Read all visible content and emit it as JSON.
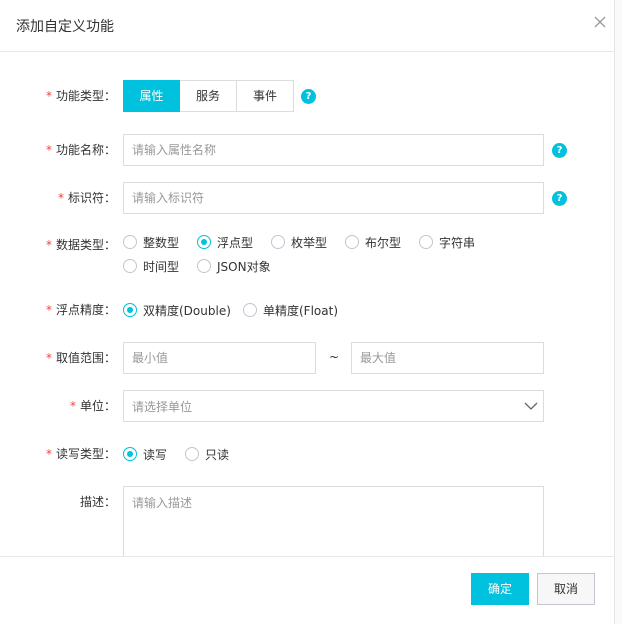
{
  "dialog": {
    "title": "添加自定义功能"
  },
  "required_mark": "*",
  "func_type": {
    "label": "功能类型：",
    "options": [
      "属性",
      "服务",
      "事件"
    ],
    "selected": "属性"
  },
  "func_name": {
    "label": "功能名称：",
    "placeholder": "请输入属性名称"
  },
  "identifier": {
    "label": "标识符：",
    "placeholder": "请输入标识符"
  },
  "data_type": {
    "label": "数据类型：",
    "options": [
      "整数型",
      "浮点型",
      "枚举型",
      "布尔型",
      "字符串",
      "时间型",
      "JSON对象"
    ],
    "selected": "浮点型"
  },
  "precision": {
    "label": "浮点精度：",
    "options": [
      "双精度(Double)",
      "单精度(Float)"
    ],
    "selected": "双精度(Double)"
  },
  "value_range": {
    "label": "取值范围：",
    "min_placeholder": "最小值",
    "separator": "~",
    "max_placeholder": "最大值"
  },
  "unit": {
    "label": "单位：",
    "placeholder": "请选择单位"
  },
  "rw_type": {
    "label": "读写类型：",
    "options": [
      "读写",
      "只读"
    ],
    "selected": "读写"
  },
  "description": {
    "label": "描述：",
    "placeholder": "请输入描述"
  },
  "footer": {
    "confirm_label": "确定",
    "cancel_label": "取消"
  },
  "help_glyph": "?",
  "colors": {
    "accent": "#00c1de",
    "required": "#f04134",
    "border": "#dcdcdc"
  }
}
